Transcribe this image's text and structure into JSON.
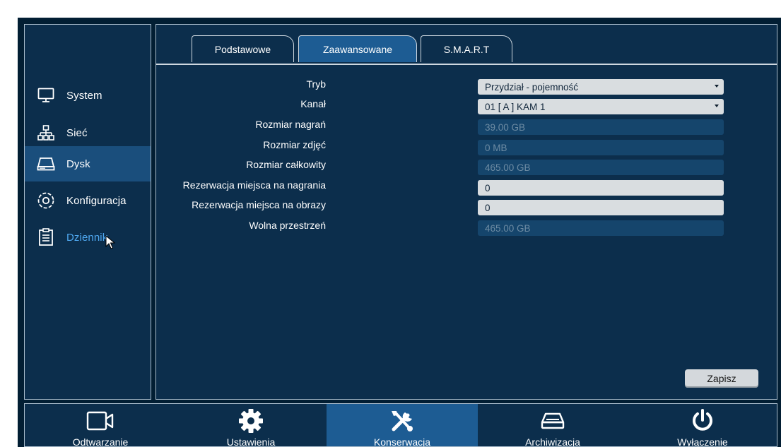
{
  "sidebar": {
    "items": [
      {
        "label": "System",
        "icon": "monitor-icon"
      },
      {
        "label": "Sieć",
        "icon": "network-icon"
      },
      {
        "label": "Dysk",
        "icon": "disk-icon"
      },
      {
        "label": "Konfiguracja",
        "icon": "gear-outline-icon"
      },
      {
        "label": "Dziennik",
        "icon": "clipboard-icon"
      }
    ],
    "active": "Dysk"
  },
  "tabs": {
    "items": [
      "Podstawowe",
      "Zaawansowane",
      "S.M.A.R.T"
    ],
    "active": "Zaawansowane"
  },
  "form": {
    "tryb": {
      "label": "Tryb",
      "value": "Przydział - pojemność"
    },
    "kanal": {
      "label": "Kanał",
      "value": "01 [ A ] KAM 1"
    },
    "rozmiar_nagran": {
      "label": "Rozmiar nagrań",
      "value": "39.00 GB"
    },
    "rozmiar_zdjec": {
      "label": "Rozmiar zdjęć",
      "value": "0 MB"
    },
    "rozmiar_calkowity": {
      "label": "Rozmiar całkowity",
      "value": "465.00 GB"
    },
    "rezerwacja_nagrania": {
      "label": "Rezerwacja miejsca na nagrania",
      "value": "0"
    },
    "rezerwacja_obrazy": {
      "label": "Rezerwacja miejsca na obrazy",
      "value": "0"
    },
    "wolna_przestrzen": {
      "label": "Wolna przestrzeń",
      "value": "465.00 GB"
    }
  },
  "save_label": "Zapisz",
  "bottombar": {
    "items": [
      {
        "label": "Odtwarzanie",
        "icon": "video-camera-icon"
      },
      {
        "label": "Ustawienia",
        "icon": "gear-icon"
      },
      {
        "label": "Konserwacja",
        "icon": "tools-icon"
      },
      {
        "label": "Archiwizacja",
        "icon": "archive-drive-icon"
      },
      {
        "label": "Wyłączenie",
        "icon": "power-icon"
      }
    ],
    "active": "Konserwacja"
  },
  "colors": {
    "background": "#021e33",
    "panel": "#0c2e4c",
    "active": "#1d5c93",
    "sidebar_active": "#1a4e7c",
    "hover_text": "#4fa8f0"
  }
}
